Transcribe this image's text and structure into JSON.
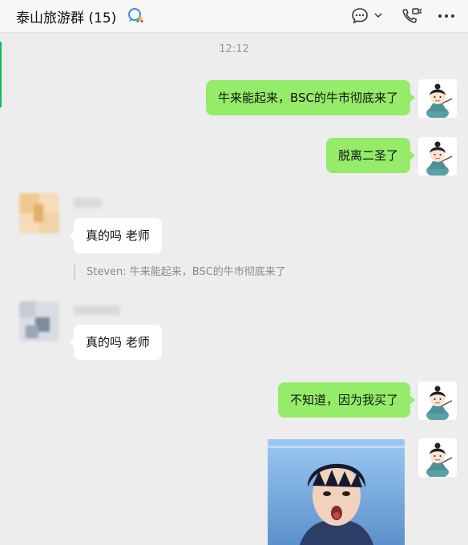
{
  "header": {
    "chat_title": "泰山旅游群 (15)"
  },
  "messages": {
    "timestamp": "12:12",
    "msg1": "牛来能起来，BSC的牛市彻底来了",
    "msg2": "脱离二圣了",
    "msg3": "真的吗 老师",
    "quote": "Steven: 牛来能起来，BSC的牛市彻底来了",
    "msg4": "真的吗 老师",
    "msg5": "不知道，因为我买了"
  },
  "colors": {
    "outgoing_bubble": "#95ec69",
    "incoming_bubble": "#ffffff",
    "background": "#ededed",
    "accent": "#07c160"
  },
  "icons": [
    "group-chat-icon",
    "chat-bubble-icon",
    "chevron-down-icon",
    "phone-video-icon",
    "more-icon"
  ]
}
